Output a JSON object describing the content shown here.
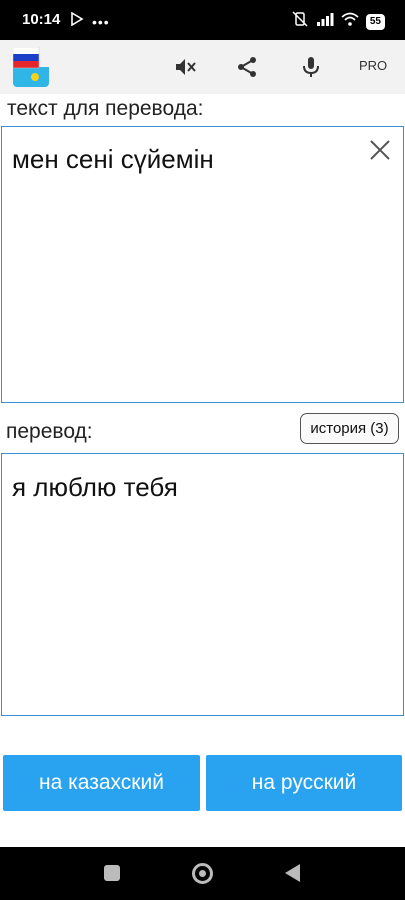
{
  "status_bar": {
    "time": "10:14",
    "battery": "55"
  },
  "toolbar": {
    "pro_label": "PRO"
  },
  "source": {
    "label": "текст для перевода:",
    "text": "мен сені сүйемін"
  },
  "target": {
    "label": "перевод:",
    "text": "я люблю тебя"
  },
  "history_button": "история (3)",
  "buttons": {
    "to_kazakh": "на казахский",
    "to_russian": "на русский"
  },
  "colors": {
    "accent": "#29a3f0",
    "border": "#3a8fd9",
    "status_bar": "#000000",
    "app_bar": "#f2f2f2"
  }
}
